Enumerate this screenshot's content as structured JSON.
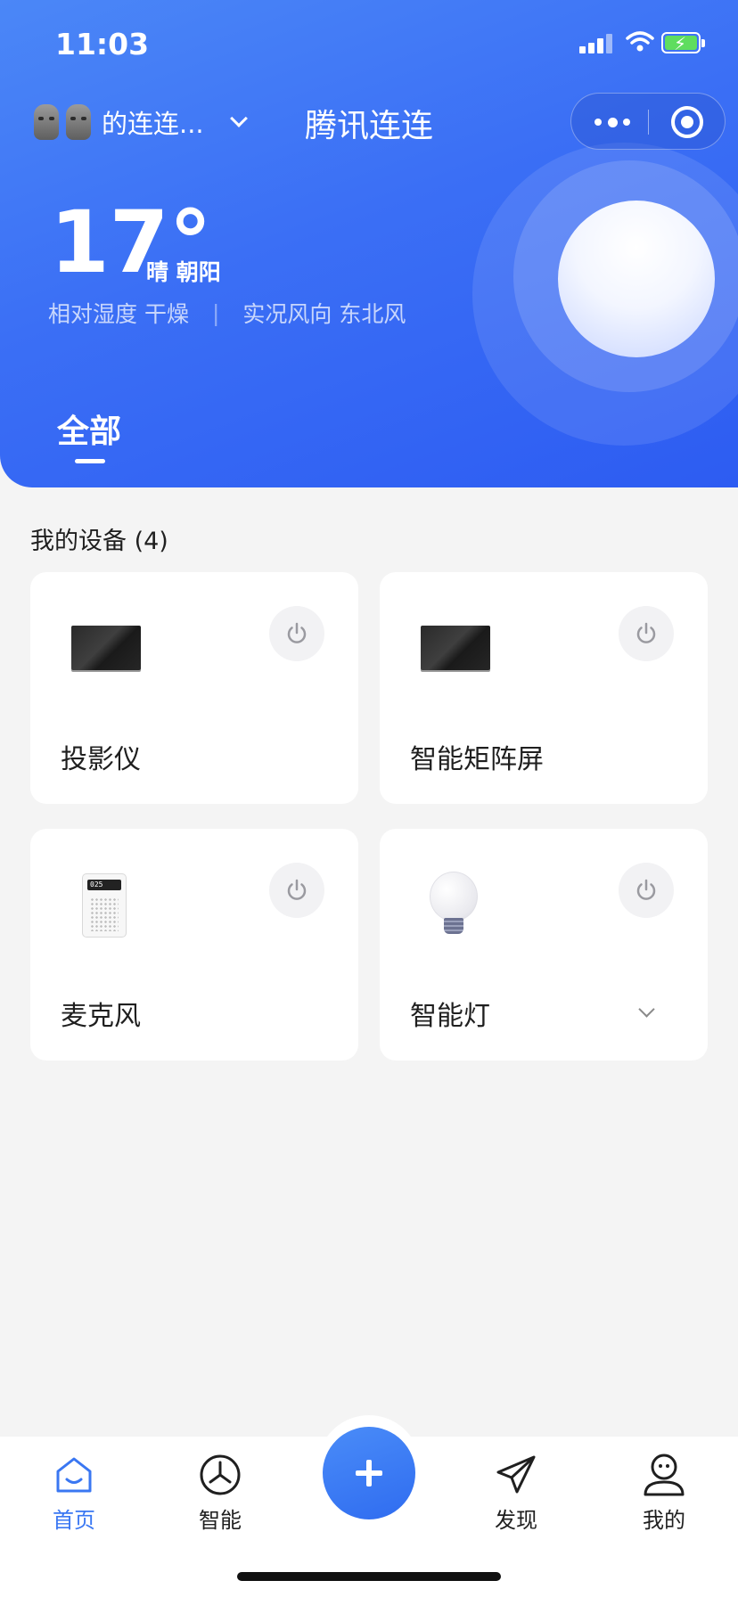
{
  "status_bar": {
    "time": "11:03"
  },
  "header": {
    "home_name": "的连连...",
    "app_title": "腾讯连连",
    "weather": {
      "temperature": "17°",
      "condition": "晴 朝阳",
      "humidity": "相对湿度 干燥",
      "separator": "|",
      "wind": "实况风向 东北风"
    },
    "tab_all": "全部"
  },
  "devices": {
    "section_title": "我的设备 (4)",
    "items": [
      {
        "label": "投影仪",
        "icon": "tv-icon"
      },
      {
        "label": "智能矩阵屏",
        "icon": "tv-icon"
      },
      {
        "label": "麦克风",
        "icon": "air-purifier-icon",
        "screen_text": "025"
      },
      {
        "label": "智能灯",
        "icon": "light-bulb-icon"
      }
    ]
  },
  "tab_bar": {
    "tabs": [
      {
        "label": "首页",
        "icon": "home-icon",
        "active": true
      },
      {
        "label": "智能",
        "icon": "smart-icon"
      },
      {
        "label": "发现",
        "icon": "discover-icon"
      },
      {
        "label": "我的",
        "icon": "profile-icon"
      }
    ],
    "add_icon": "plus-icon"
  },
  "colors": {
    "accent": "#3a77f2",
    "header_gradient_start": "#4b87f7",
    "header_gradient_end": "#2d5cf2",
    "background": "#f4f4f4"
  }
}
